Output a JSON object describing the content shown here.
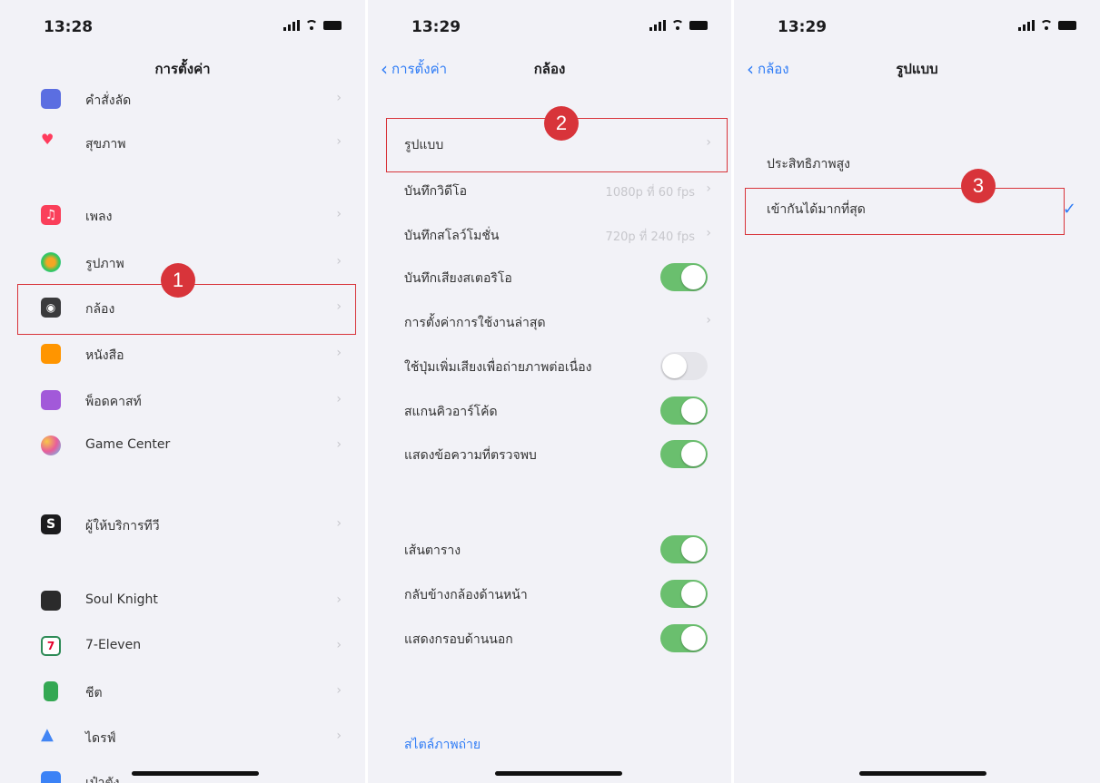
{
  "panel1": {
    "time": "13:28",
    "title": "การตั้งค่า",
    "items": [
      {
        "label": "คำสั่งลัด",
        "icon": "shortcuts-icon",
        "color": "#5b6ee1"
      },
      {
        "label": "สุขภาพ",
        "icon": "health-heart-icon",
        "color": "#ff3b5c"
      },
      {
        "label": "เพลง",
        "icon": "music-icon",
        "color": "#fa3f5a"
      },
      {
        "label": "รูปภาพ",
        "icon": "photos-icon",
        "color": "#f4a623"
      },
      {
        "label": "กล้อง",
        "icon": "camera-icon",
        "color": "#8e8e93"
      },
      {
        "label": "หนังสือ",
        "icon": "books-icon",
        "color": "#ff9500"
      },
      {
        "label": "พ็อดคาสท์",
        "icon": "podcasts-icon",
        "color": "#a259d9"
      },
      {
        "label": "Game Center",
        "icon": "game-center-icon",
        "color": "#e85d9b"
      },
      {
        "label": "ผู้ให้บริการทีวี",
        "icon": "tv-provider-icon",
        "color": "#1c1c1e"
      },
      {
        "label": "Soul Knight",
        "icon": "soul-knight-icon",
        "color": "#2b2b2b"
      },
      {
        "label": "7-Eleven",
        "icon": "seven-eleven-icon",
        "color": "#2e8b57"
      },
      {
        "label": "ชีต",
        "icon": "sheets-icon",
        "color": "#34a853"
      },
      {
        "label": "ไดรฟ์",
        "icon": "drive-icon",
        "color": "#4285f4"
      },
      {
        "label": "เป๋าตัง",
        "icon": "paotang-icon",
        "color": "#3b82f6"
      }
    ],
    "badge": "1"
  },
  "panel2": {
    "time": "13:29",
    "back": "การตั้งค่า",
    "title": "กล้อง",
    "badge": "2",
    "rows": [
      {
        "label": "รูปแบบ"
      },
      {
        "label": "บันทึกวิดีโอ",
        "value": "1080p ที่ 60 fps"
      },
      {
        "label": "บันทึกสโลว์โมชั่น",
        "value": "720p ที่ 240 fps"
      },
      {
        "label": "บันทึกเสียงสเตอริโอ"
      },
      {
        "label": "การตั้งค่าการใช้งานล่าสุด"
      },
      {
        "label": "ใช้ปุ่มเพิ่มเสียงเพื่อถ่ายภาพต่อเนื่อง"
      },
      {
        "label": "สแกนคิวอาร์โค้ด"
      },
      {
        "label": "แสดงข้อความที่ตรวจพบ"
      },
      {
        "label": "เส้นตาราง"
      },
      {
        "label": "กลับข้างกล้องด้านหน้า"
      },
      {
        "label": "แสดงกรอบด้านนอก"
      }
    ],
    "link": "สไตล์ภาพถ่าย"
  },
  "panel3": {
    "time": "13:29",
    "back": "กล้อง",
    "title": "รูปแบบ",
    "badge": "3",
    "options": [
      {
        "label": "ประสิทธิภาพสูง"
      },
      {
        "label": "เข้ากันได้มากที่สุด"
      }
    ],
    "check": "✓"
  },
  "colors": {
    "accent": "#2f7cf6",
    "toggle_on": "#6abf6e",
    "highlight": "#d8343a"
  }
}
